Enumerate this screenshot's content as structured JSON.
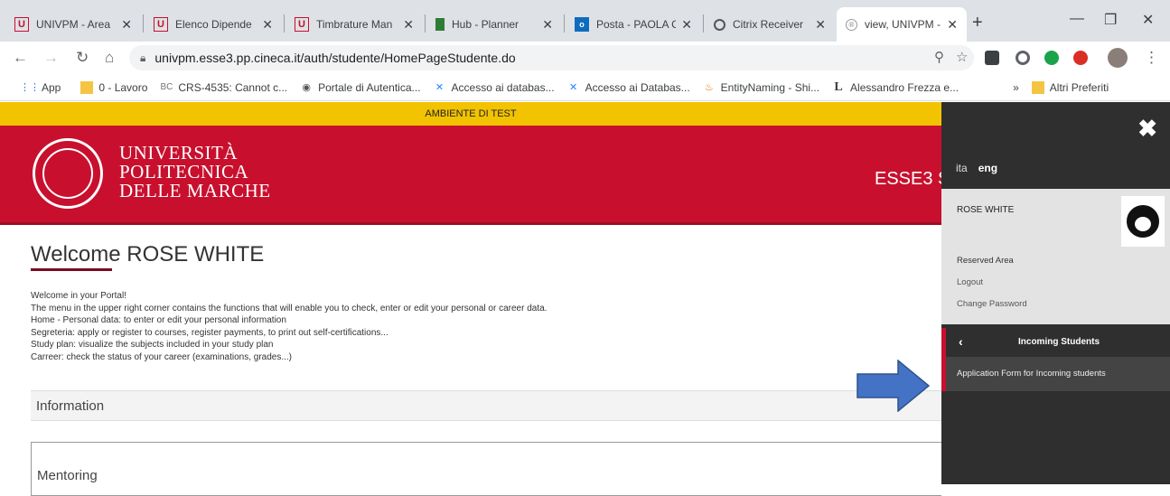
{
  "browser": {
    "tabs": [
      {
        "title": "UNIVPM - Area",
        "favicon": "univpm-icon",
        "color": "#c8102e"
      },
      {
        "title": "Elenco Dipende",
        "favicon": "univpm-icon",
        "color": "#c8102e"
      },
      {
        "title": "Timbrature Man",
        "favicon": "univpm-icon",
        "color": "#c8102e"
      },
      {
        "title": "Hub - Planner",
        "favicon": "hub-planner-icon",
        "color": "#2e7d32"
      },
      {
        "title": "Posta - PAOLA C",
        "favicon": "outlook-icon",
        "color": "#0f6cbd"
      },
      {
        "title": "Citrix Receiver",
        "favicon": "citrix-icon",
        "color": "#555555"
      },
      {
        "title": "view, UNIVPM -",
        "favicon": "view-icon",
        "color": "#999999"
      }
    ],
    "url": "univpm.esse3.pp.cineca.it/auth/studente/HomePageStudente.do",
    "bookmarks": [
      {
        "label": "App",
        "icon": "apps-grid-icon"
      },
      {
        "label": "0 - Lavoro",
        "icon": "folder-icon"
      },
      {
        "label": "CRS-4535: Cannot c...",
        "icon": "bc-icon"
      },
      {
        "label": "Portale di Autentica...",
        "icon": "globe-icon"
      },
      {
        "label": "Accesso ai databas...",
        "icon": "confluence-icon"
      },
      {
        "label": "Accesso ai Databas...",
        "icon": "confluence-icon"
      },
      {
        "label": "EntityNaming - Shi...",
        "icon": "fire-icon"
      },
      {
        "label": "Alessandro Frezza e...",
        "icon": "l-icon"
      }
    ],
    "bookmarks_more": "»",
    "other_bookmarks": "Altri Preferiti"
  },
  "page": {
    "test_banner": "AMBIENTE DI TEST",
    "university": {
      "line1": "UNIVERSITÀ",
      "line2": "POLITECNICA",
      "line3": "DELLE MARCHE"
    },
    "esse3_label": "ESSE3 S",
    "welcome": "Welcome ROSE WHITE",
    "intro_lines": [
      "Welcome in your Portal!",
      "The menu in the upper right corner contains the functions that will enable you to check, enter or edit your personal or career data.",
      "Home - Personal data: to enter or edit your personal information",
      "Segreteria: apply or register to courses, register payments, to print out self-certifications...",
      "Study plan: visualize the subjects included in your study plan",
      "Carreer: check the status of your career (examinations, grades...)"
    ],
    "information_title": "Information",
    "mentoring_title": "Mentoring"
  },
  "panel": {
    "lang_ita": "ita",
    "lang_eng": "eng",
    "user_name": "ROSE WHITE",
    "reserved_area": "Reserved Area",
    "logout": "Logout",
    "change_password": "Change Password",
    "incoming_students": "Incoming Students",
    "application_form": "Application Form for Incoming students"
  },
  "colors": {
    "brand_red": "#c8102e",
    "test_yellow": "#f2c300",
    "panel_dark": "#2f2f2f",
    "arrow_blue": "#4472c4"
  }
}
